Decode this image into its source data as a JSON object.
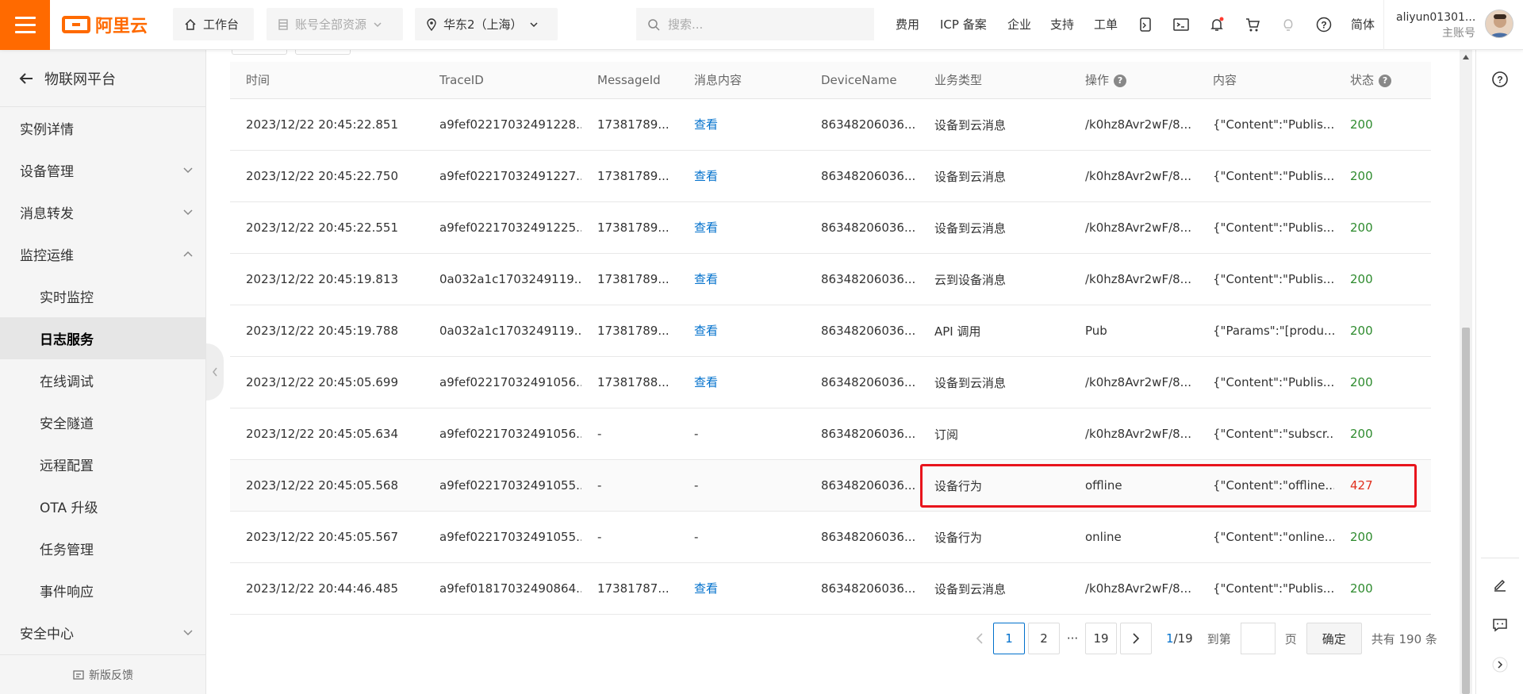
{
  "header": {
    "logo_text": "阿里云",
    "workbench": "工作台",
    "resources": "账号全部资源",
    "region": "华东2（上海）",
    "search_placeholder": "搜索...",
    "links": [
      "费用",
      "ICP 备案",
      "企业",
      "支持",
      "工单"
    ],
    "lang": "简体",
    "user_name": "aliyun01301...",
    "user_role": "主账号"
  },
  "sidebar": {
    "back_title": "物联网平台",
    "items": [
      {
        "label": "实例详情",
        "expand": "none"
      },
      {
        "label": "设备管理",
        "expand": "down"
      },
      {
        "label": "消息转发",
        "expand": "down"
      },
      {
        "label": "监控运维",
        "expand": "up"
      },
      {
        "label": "实时监控",
        "sub": true
      },
      {
        "label": "日志服务",
        "sub": true,
        "active": true
      },
      {
        "label": "在线调试",
        "sub": true
      },
      {
        "label": "安全隧道",
        "sub": true
      },
      {
        "label": "远程配置",
        "sub": true
      },
      {
        "label": "OTA 升级",
        "sub": true
      },
      {
        "label": "任务管理",
        "sub": true
      },
      {
        "label": "事件响应",
        "sub": true
      },
      {
        "label": "安全中心",
        "expand": "down"
      }
    ],
    "feedback": "新版反馈"
  },
  "table": {
    "columns": [
      "时间",
      "TraceID",
      "MessageId",
      "消息内容",
      "DeviceName",
      "业务类型",
      "操作",
      "内容",
      "状态"
    ],
    "help_columns": [
      6,
      8
    ],
    "rows": [
      [
        "2023/12/22 20:45:22.851",
        "a9fef02217032491228...",
        "17381789...",
        "查看",
        "86348206036...",
        "设备到云消息",
        "/k0hz8Avr2wF/8...",
        "{\"Content\":\"Publis...",
        "200"
      ],
      [
        "2023/12/22 20:45:22.750",
        "a9fef02217032491227...",
        "17381789...",
        "查看",
        "86348206036...",
        "设备到云消息",
        "/k0hz8Avr2wF/8...",
        "{\"Content\":\"Publis...",
        "200"
      ],
      [
        "2023/12/22 20:45:22.551",
        "a9fef02217032491225...",
        "17381789...",
        "查看",
        "86348206036...",
        "设备到云消息",
        "/k0hz8Avr2wF/8...",
        "{\"Content\":\"Publis...",
        "200"
      ],
      [
        "2023/12/22 20:45:19.813",
        "0a032a1c1703249119...",
        "17381789...",
        "查看",
        "86348206036...",
        "云到设备消息",
        "/k0hz8Avr2wF/8...",
        "{\"Content\":\"Publis...",
        "200"
      ],
      [
        "2023/12/22 20:45:19.788",
        "0a032a1c1703249119...",
        "17381789...",
        "查看",
        "86348206036...",
        "API 调用",
        "Pub",
        "{\"Params\":\"[produ...",
        "200"
      ],
      [
        "2023/12/22 20:45:05.699",
        "a9fef02217032491056...",
        "17381788...",
        "查看",
        "86348206036...",
        "设备到云消息",
        "/k0hz8Avr2wF/8...",
        "{\"Content\":\"Publis...",
        "200"
      ],
      [
        "2023/12/22 20:45:05.634",
        "a9fef02217032491056...",
        "-",
        "-",
        "86348206036...",
        "订阅",
        "/k0hz8Avr2wF/8...",
        "{\"Content\":\"subscr...",
        "200"
      ],
      [
        "2023/12/22 20:45:05.568",
        "a9fef02217032491055...",
        "-",
        "-",
        "86348206036...",
        "设备行为",
        "offline",
        "{\"Content\":\"offline...",
        "427"
      ],
      [
        "2023/12/22 20:45:05.567",
        "a9fef02217032491055...",
        "-",
        "-",
        "86348206036...",
        "设备行为",
        "online",
        "{\"Content\":\"online...",
        "200"
      ],
      [
        "2023/12/22 20:44:46.485",
        "a9fef01817032490864...",
        "17381787...",
        "查看",
        "86348206036...",
        "设备到云消息",
        "/k0hz8Avr2wF/8...",
        "{\"Content\":\"Publis...",
        "200"
      ]
    ],
    "highlighted_row": 7
  },
  "pagination": {
    "pages": [
      "1",
      "2",
      "···",
      "19"
    ],
    "current": "1",
    "page_of": "/19",
    "goto_label": "到第",
    "page_unit": "页",
    "confirm": "确定",
    "total": "共有 190 条"
  },
  "colors": {
    "brand": "#ff6a00",
    "link": "#0070cc",
    "success": "#2e8b2e",
    "error": "#e0301e",
    "highlight_box": "#e8141c"
  }
}
